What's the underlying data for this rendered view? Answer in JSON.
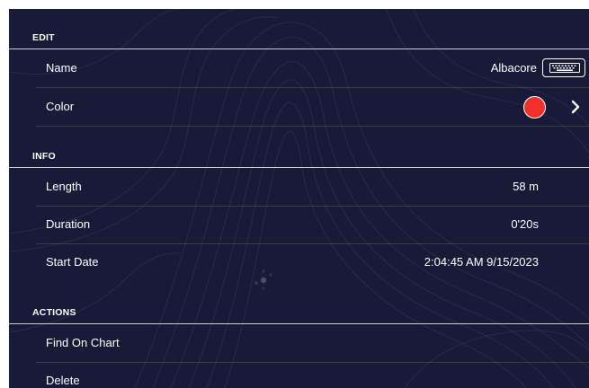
{
  "sections": {
    "edit": {
      "header": "EDIT",
      "name_label": "Name",
      "name_value": "Albacore",
      "color_label": "Color",
      "color_value": "#f0302a"
    },
    "info": {
      "header": "INFO",
      "length_label": "Length",
      "length_value": "58 m",
      "duration_label": "Duration",
      "duration_value": "0'20s",
      "start_date_label": "Start Date",
      "start_date_value": "2:04:45 AM 9/15/2023"
    },
    "actions": {
      "header": "ACTIONS",
      "find_on_chart": "Find On Chart",
      "delete": "Delete"
    }
  },
  "icons": {
    "keyboard": "keyboard-icon",
    "chevron": "chevron-right-icon"
  },
  "colors": {
    "background": "#171b38",
    "accent_red": "#f0302a"
  }
}
